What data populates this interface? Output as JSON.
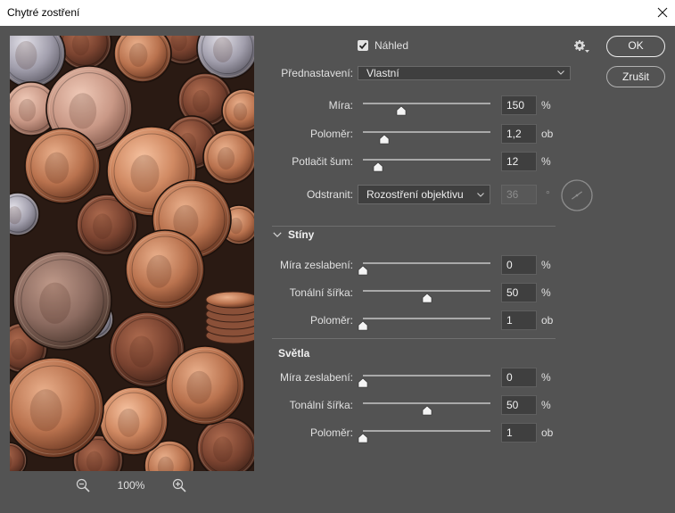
{
  "theme": {
    "panel_bg": "#535353",
    "titlebar_bg": "#ffffff",
    "title_text": "#000000",
    "text": "#e0e0e0",
    "field_bg": "#3f3f3f"
  },
  "window": {
    "title": "Chytré zostření",
    "close_icon": "close-icon"
  },
  "preview": {
    "zoom_out_icon": "zoom-out-icon",
    "zoom_level": "100%",
    "zoom_in_icon": "zoom-in-icon"
  },
  "toolbar": {
    "preview_label": "Náhled",
    "preview_checked": true,
    "settings_icon": "gear-icon"
  },
  "buttons": {
    "ok": "OK",
    "cancel": "Zrušit"
  },
  "preset": {
    "label": "Přednastavení:",
    "value": "Vlastní",
    "icon": "chevron-down-icon"
  },
  "sharpen": {
    "amount": {
      "label": "Míra:",
      "value": "150",
      "unit": "%",
      "level": 0.3
    },
    "radius": {
      "label": "Poloměr:",
      "value": "1,2",
      "unit": "ob",
      "level": 0.17
    },
    "reduce_noise": {
      "label": "Potlačit šum:",
      "value": "12",
      "unit": "%",
      "level": 0.12
    },
    "remove": {
      "label": "Odstranit:",
      "value": "Rozostření objektivu",
      "angle": "36",
      "angle_unit": "°",
      "angle_enabled": false
    }
  },
  "shadows": {
    "title": "Stíny",
    "expanded": true,
    "fade_amount": {
      "label": "Míra zeslabení:",
      "value": "0",
      "unit": "%",
      "level": 0
    },
    "tonal_width": {
      "label": "Tonální šířka:",
      "value": "50",
      "unit": "%",
      "level": 0.5
    },
    "radius": {
      "label": "Poloměr:",
      "value": "1",
      "unit": "ob",
      "level": 0
    }
  },
  "highlights": {
    "title": "Světla",
    "fade_amount": {
      "label": "Míra zeslabení:",
      "value": "0",
      "unit": "%",
      "level": 0
    },
    "tonal_width": {
      "label": "Tonální šířka:",
      "value": "50",
      "unit": "%",
      "level": 0.5
    },
    "radius": {
      "label": "Poloměr:",
      "value": "1",
      "unit": "ob",
      "level": 0
    }
  }
}
